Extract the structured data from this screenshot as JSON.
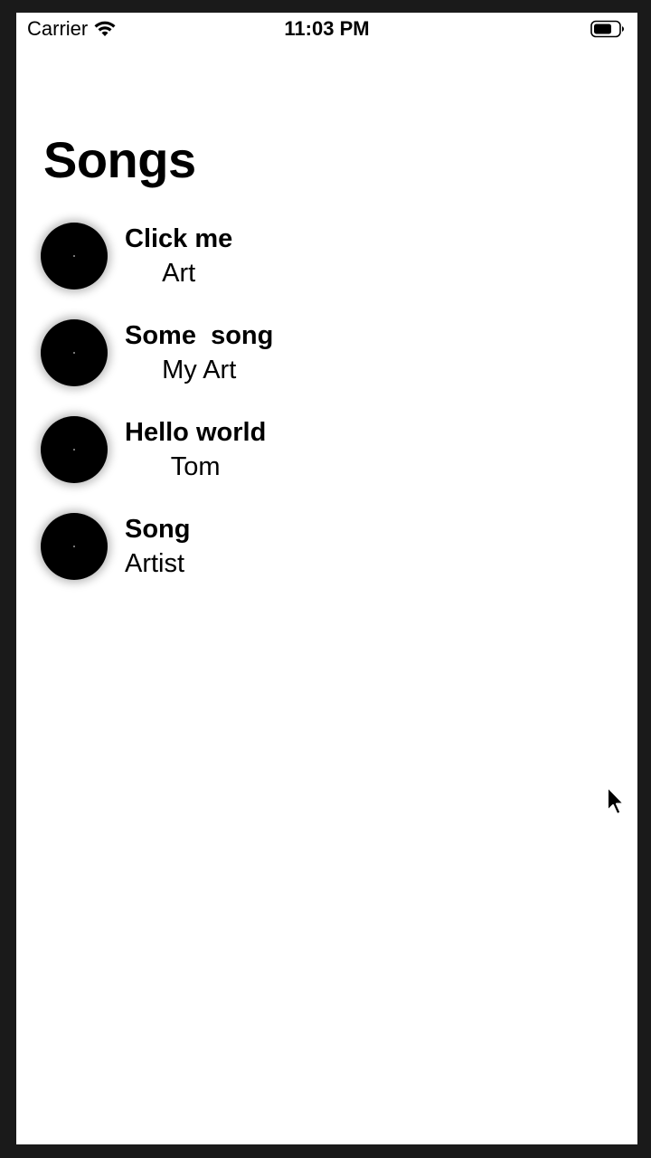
{
  "status_bar": {
    "carrier": "Carrier",
    "time": "11:03 PM",
    "icons": [
      "wifi-icon",
      "battery-icon"
    ]
  },
  "page": {
    "title": "Songs"
  },
  "songs": [
    {
      "title": "Click me",
      "artist": "Art",
      "align": "center"
    },
    {
      "title": "Some  song",
      "artist": "My Art",
      "align": "center"
    },
    {
      "title": "Hello world",
      "artist": "Tom",
      "align": "center"
    },
    {
      "title": "Song",
      "artist": "Artist",
      "align": "left"
    }
  ],
  "colors": {
    "background": "#ffffff",
    "text": "#000000",
    "disc": "#000000"
  }
}
